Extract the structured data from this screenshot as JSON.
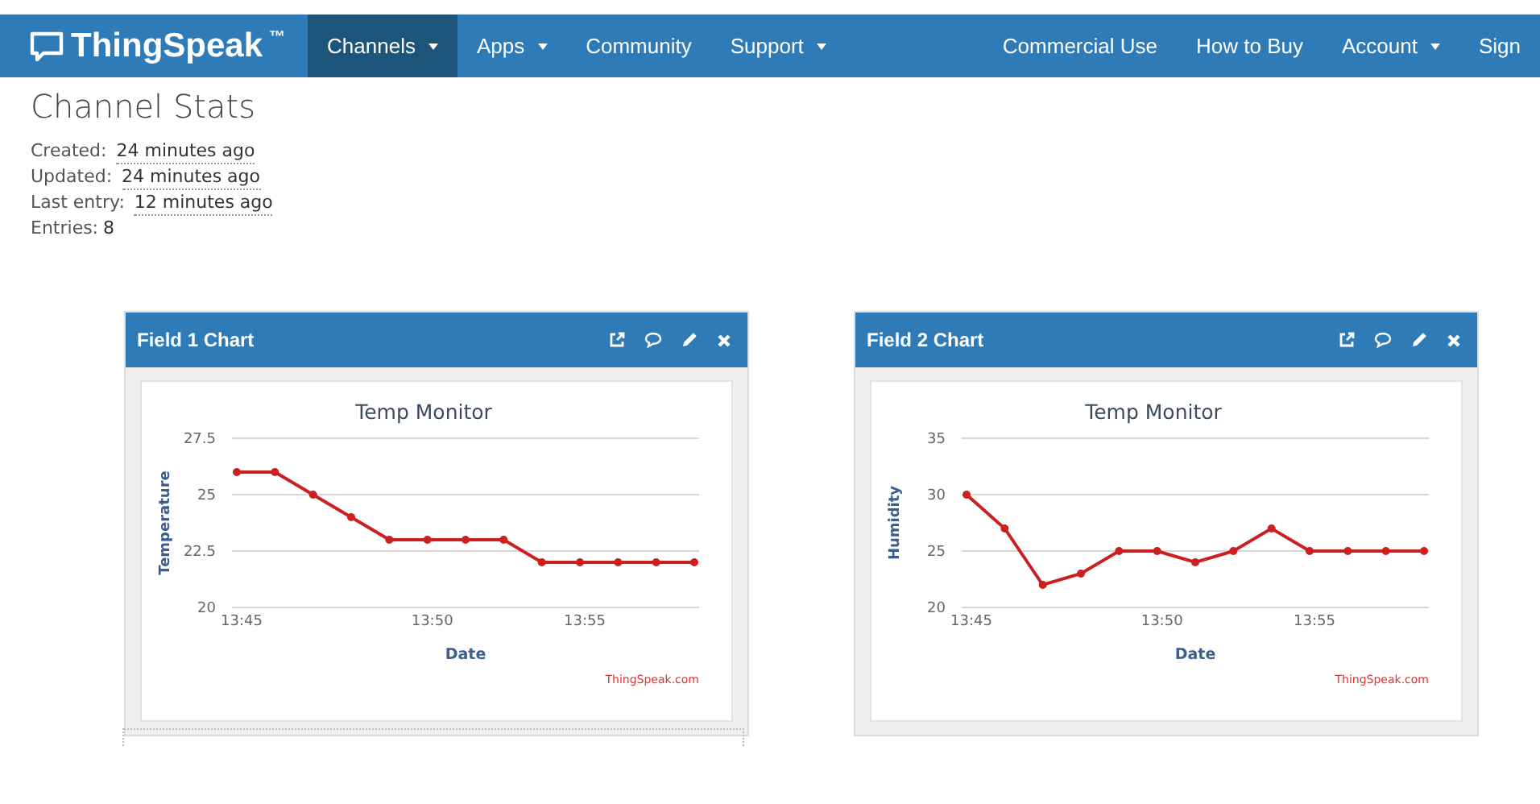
{
  "navbar": {
    "brand": "ThingSpeak",
    "brand_mark": "™",
    "left_items": [
      {
        "label": "Channels",
        "dropdown": true,
        "selected": true
      },
      {
        "label": "Apps",
        "dropdown": true,
        "selected": false
      },
      {
        "label": "Community",
        "dropdown": false,
        "selected": false
      },
      {
        "label": "Support",
        "dropdown": true,
        "selected": false
      }
    ],
    "right_items": [
      {
        "label": "Commercial Use",
        "dropdown": false,
        "selected": false
      },
      {
        "label": "How to Buy",
        "dropdown": false,
        "selected": false
      },
      {
        "label": "Account",
        "dropdown": true,
        "selected": false
      },
      {
        "label": "Sign",
        "dropdown": false,
        "selected": false
      }
    ]
  },
  "page_title": "Channel Stats",
  "stats": [
    {
      "label": "Created:",
      "value": "24 minutes ago",
      "kind": "time"
    },
    {
      "label": "Updated:",
      "value": "24 minutes ago",
      "kind": "time"
    },
    {
      "label": "Last entry:",
      "value": "12 minutes ago",
      "kind": "time"
    },
    {
      "label": "Entries:",
      "value": "8",
      "kind": "count"
    }
  ],
  "cards": [
    {
      "title": "Field 1 Chart",
      "credit": "ThingSpeak.com",
      "chart_data": {
        "type": "line",
        "title": "Temp Monitor",
        "xlabel": "Date",
        "ylabel": "Temperature",
        "categories": [
          "13:45",
          null,
          null,
          null,
          null,
          "13:50",
          null,
          null,
          null,
          "13:55",
          null,
          null,
          null
        ],
        "series": [
          {
            "color": "#cc1f1f",
            "marker": "circle",
            "values": [
              26,
              26,
              25,
              24,
              23,
              23,
              23,
              23,
              22,
              22,
              22,
              22,
              22
            ]
          }
        ],
        "ylim": [
          20,
          27.5
        ],
        "yticks": [
          20,
          22.5,
          25,
          27.5
        ]
      }
    },
    {
      "title": "Field 2 Chart",
      "credit": "ThingSpeak.com",
      "chart_data": {
        "type": "line",
        "title": "Temp Monitor",
        "xlabel": "Date",
        "ylabel": "Humidity",
        "categories": [
          "13:45",
          null,
          null,
          null,
          null,
          "13:50",
          null,
          null,
          null,
          "13:55",
          null,
          null,
          null
        ],
        "series": [
          {
            "color": "#cc1f1f",
            "marker": "circle",
            "values": [
              30,
              27,
              22,
              23,
              25,
              25,
              24,
              25,
              27,
              25,
              25,
              25,
              25
            ]
          }
        ],
        "ylim": [
          20,
          35
        ],
        "yticks": [
          20,
          25,
          30,
          35
        ]
      }
    }
  ]
}
